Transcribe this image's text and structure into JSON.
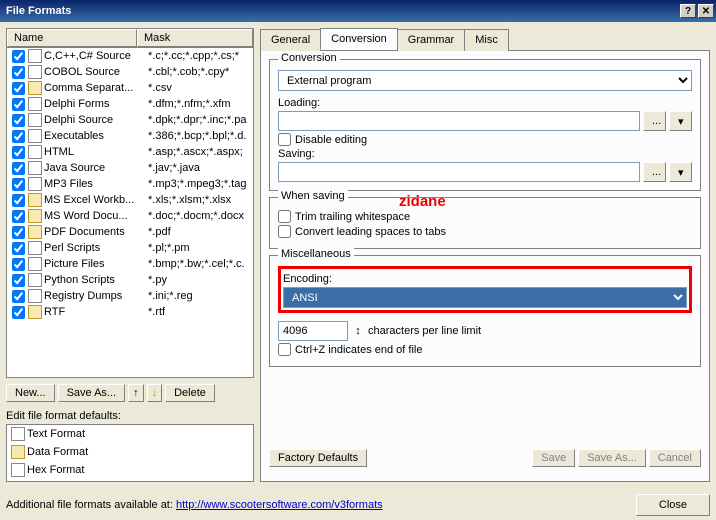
{
  "title": "File Formats",
  "cols": {
    "name": "Name",
    "mask": "Mask"
  },
  "rows": [
    {
      "name": "C,C++,C# Source",
      "mask": "*.c;*.cc;*.cpp;*.cs;*",
      "ico": "file"
    },
    {
      "name": "COBOL Source",
      "mask": "*.cbl;*.cob;*.cpy*",
      "ico": "file"
    },
    {
      "name": "Comma Separat...",
      "mask": "*.csv",
      "ico": "fold"
    },
    {
      "name": "Delphi Forms",
      "mask": "*.dfm;*.nfm;*.xfm",
      "ico": "file"
    },
    {
      "name": "Delphi Source",
      "mask": "*.dpk;*.dpr;*.inc;*.pa",
      "ico": "file"
    },
    {
      "name": "Executables",
      "mask": "*.386;*.bcp;*.bpl;*.d.",
      "ico": "file"
    },
    {
      "name": "HTML",
      "mask": "*.asp;*.ascx;*.aspx;",
      "ico": "file"
    },
    {
      "name": "Java Source",
      "mask": "*.jav;*.java",
      "ico": "file"
    },
    {
      "name": "MP3 Files",
      "mask": "*.mp3;*.mpeg3;*.tag",
      "ico": "file"
    },
    {
      "name": "MS Excel Workb...",
      "mask": "*.xls;*.xlsm;*.xlsx",
      "ico": "fold"
    },
    {
      "name": "MS Word Docu...",
      "mask": "*.doc;*.docm;*.docx",
      "ico": "fold"
    },
    {
      "name": "PDF Documents",
      "mask": "*.pdf",
      "ico": "fold"
    },
    {
      "name": "Perl Scripts",
      "mask": "*.pl;*.pm",
      "ico": "file"
    },
    {
      "name": "Picture Files",
      "mask": "*.bmp;*.bw;*.cel;*.c.",
      "ico": "file"
    },
    {
      "name": "Python Scripts",
      "mask": "*.py",
      "ico": "file"
    },
    {
      "name": "Registry Dumps",
      "mask": "*.ini;*.reg",
      "ico": "file"
    },
    {
      "name": "RTF",
      "mask": "*.rtf",
      "ico": "fold"
    }
  ],
  "btns": {
    "new": "New...",
    "saveas": "Save As...",
    "delete": "Delete"
  },
  "editlbl": "Edit file format defaults:",
  "defs": [
    {
      "name": "Text Format",
      "ico": "file"
    },
    {
      "name": "Data Format",
      "ico": "fold"
    },
    {
      "name": "Hex Format",
      "ico": "file"
    }
  ],
  "tabs": {
    "general": "General",
    "conversion": "Conversion",
    "grammar": "Grammar",
    "misc": "Misc"
  },
  "conv": {
    "legend": "Conversion",
    "type": "External program",
    "loading": "Loading:",
    "saving": "Saving:",
    "disable": "Disable editing",
    "browse": "...",
    "drop": "▾"
  },
  "whensave": {
    "legend": "When saving",
    "trim": "Trim trailing whitespace",
    "convert": "Convert leading spaces to tabs"
  },
  "misc": {
    "legend": "Miscellaneous",
    "enclbl": "Encoding:",
    "enc": "ANSI",
    "chars": "4096",
    "charslbl": "characters per line limit",
    "ctrlz": "Ctrl+Z indicates end of file"
  },
  "rbtns": {
    "factory": "Factory Defaults",
    "save": "Save",
    "saveas": "Save As...",
    "cancel": "Cancel"
  },
  "footer": {
    "txt": "Additional file formats available at:",
    "link": "http://www.scootersoftware.com/v3formats",
    "close": "Close"
  },
  "ann": "zidane"
}
